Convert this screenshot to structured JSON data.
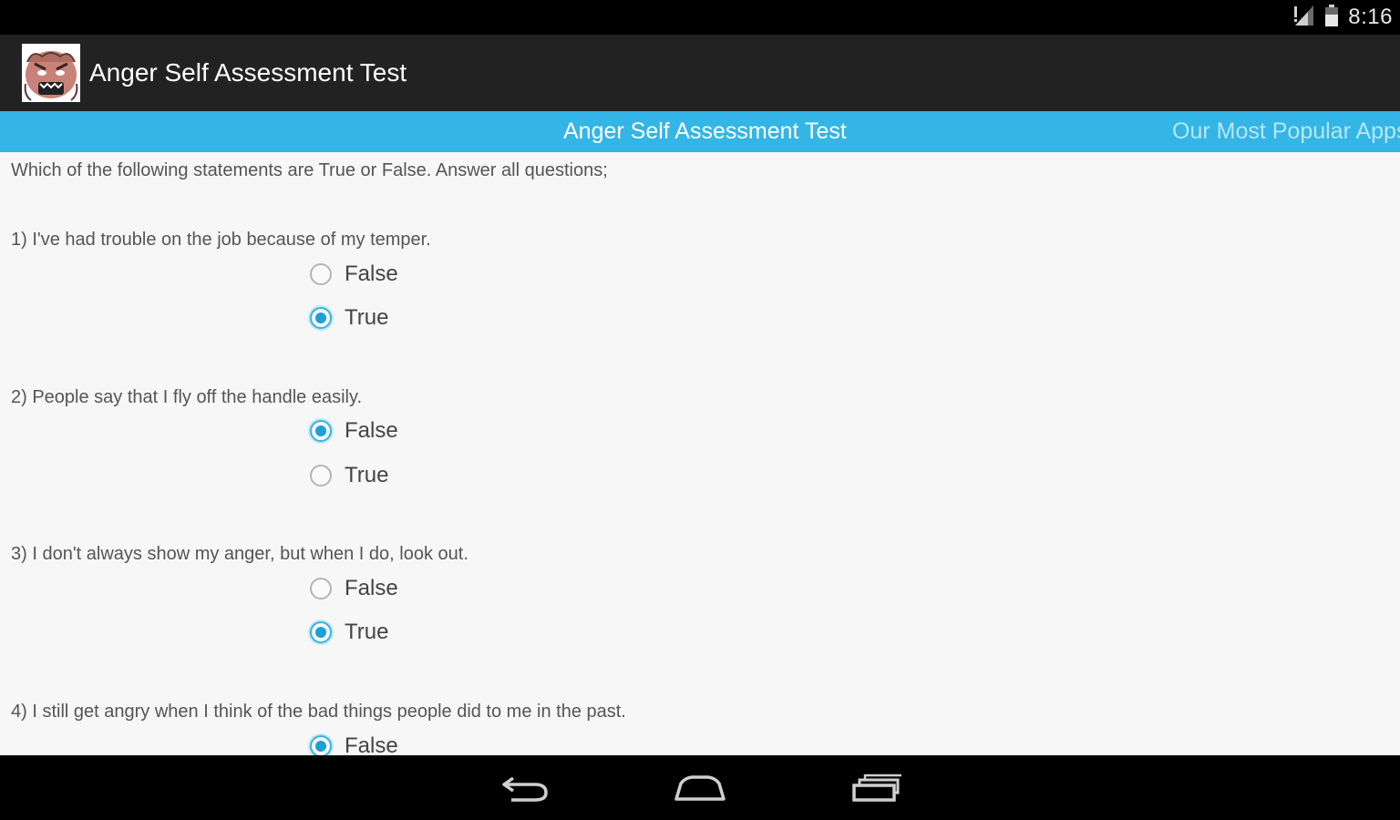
{
  "status_bar": {
    "time": "8:16",
    "icons": [
      "signal-icon",
      "battery-icon"
    ]
  },
  "action_bar": {
    "app_icon": "angry-face-logo",
    "title": "Anger Self Assessment Test"
  },
  "tabs": [
    {
      "label": "Anger Self Assessment Test",
      "active": true
    },
    {
      "label": "Our Most Popular Apps",
      "active": false
    }
  ],
  "content": {
    "intro": "Which of the following statements are True or False. Answer all questions;",
    "questions": [
      {
        "text": "1) I've had trouble on the job because of my temper.",
        "options": [
          {
            "label": "False",
            "checked": false
          },
          {
            "label": "True",
            "checked": true
          }
        ]
      },
      {
        "text": "2) People say that I fly off the handle easily.",
        "options": [
          {
            "label": "False",
            "checked": true
          },
          {
            "label": "True",
            "checked": false
          }
        ]
      },
      {
        "text": "3) I don't always show my anger, but when I do, look out.",
        "options": [
          {
            "label": "False",
            "checked": false
          },
          {
            "label": "True",
            "checked": true
          }
        ]
      },
      {
        "text": "4) I still get angry when I think of the bad things people did to me in the past.",
        "options": [
          {
            "label": "False",
            "checked": true
          }
        ]
      }
    ]
  },
  "nav_bar": {
    "buttons": [
      "back-icon",
      "home-icon",
      "recent-apps-icon"
    ]
  },
  "colors": {
    "accent": "#33b5e5",
    "action_bar": "#222222",
    "background": "#f7f7f7"
  }
}
